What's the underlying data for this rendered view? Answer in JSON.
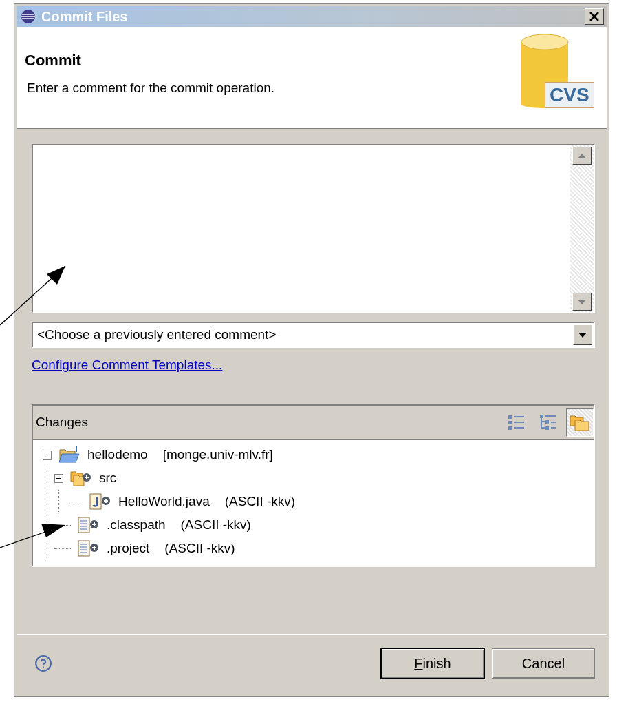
{
  "window": {
    "title": "Commit Files"
  },
  "header": {
    "title": "Commit",
    "description": "Enter a comment for the commit operation.",
    "logo_text": "CVS"
  },
  "comment_history": {
    "value": "<Choose a previously entered comment>"
  },
  "templates_link": "Configure Comment Templates...",
  "changes": {
    "title": "Changes",
    "view_modes": [
      {
        "kind": "flat",
        "selected": false
      },
      {
        "kind": "tree",
        "selected": false
      },
      {
        "kind": "compressed",
        "selected": true
      }
    ],
    "tree": [
      {
        "kind": "project",
        "name": "hellodemo",
        "detail": "[monge.univ-mlv.fr]",
        "expanded": true,
        "children": [
          {
            "kind": "folder",
            "name": "src",
            "expanded": true,
            "children": [
              {
                "kind": "java",
                "name": "HelloWorld.java",
                "detail": "(ASCII -kkv)"
              }
            ]
          },
          {
            "kind": "file",
            "name": ".classpath",
            "detail": "(ASCII -kkv)"
          },
          {
            "kind": "file",
            "name": ".project",
            "detail": "(ASCII -kkv)"
          }
        ]
      }
    ]
  },
  "buttons": [
    {
      "label": "Finish",
      "mnemonic_underlined": true,
      "default": true
    },
    {
      "label": "Cancel",
      "mnemonic_underlined": false,
      "default": false
    }
  ]
}
